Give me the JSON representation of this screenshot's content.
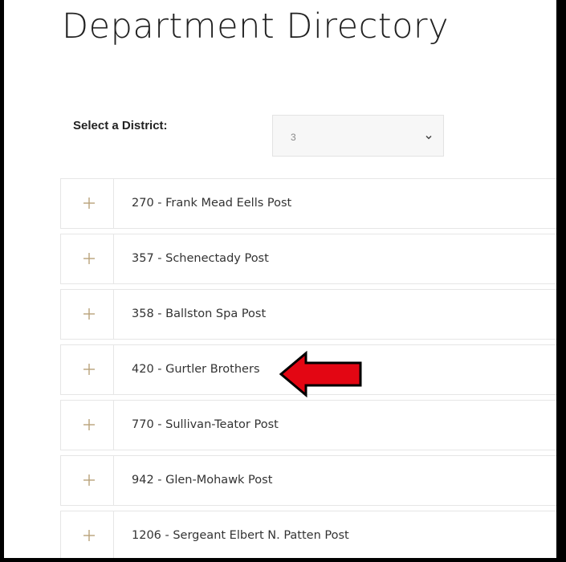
{
  "page": {
    "title": "Department Directory"
  },
  "district_filter": {
    "label": "Select a District:",
    "selected": "3"
  },
  "posts": [
    {
      "label": "270 - Frank Mead Eells Post"
    },
    {
      "label": "357 - Schenectady Post"
    },
    {
      "label": "358 - Ballston Spa Post"
    },
    {
      "label": "420 - Gurtler Brothers"
    },
    {
      "label": "770 - Sullivan-Teator Post"
    },
    {
      "label": "942 - Glen-Mohawk Post"
    },
    {
      "label": "1206 - Sergeant Elbert N. Patten Post"
    }
  ],
  "colors": {
    "plus_icon": "#b8a27a",
    "arrow_fill": "#e30613",
    "arrow_outline": "#000000"
  },
  "icons": {
    "expand": "plus-icon",
    "dropdown": "chevron-down-icon",
    "annotation": "left-arrow-icon"
  }
}
